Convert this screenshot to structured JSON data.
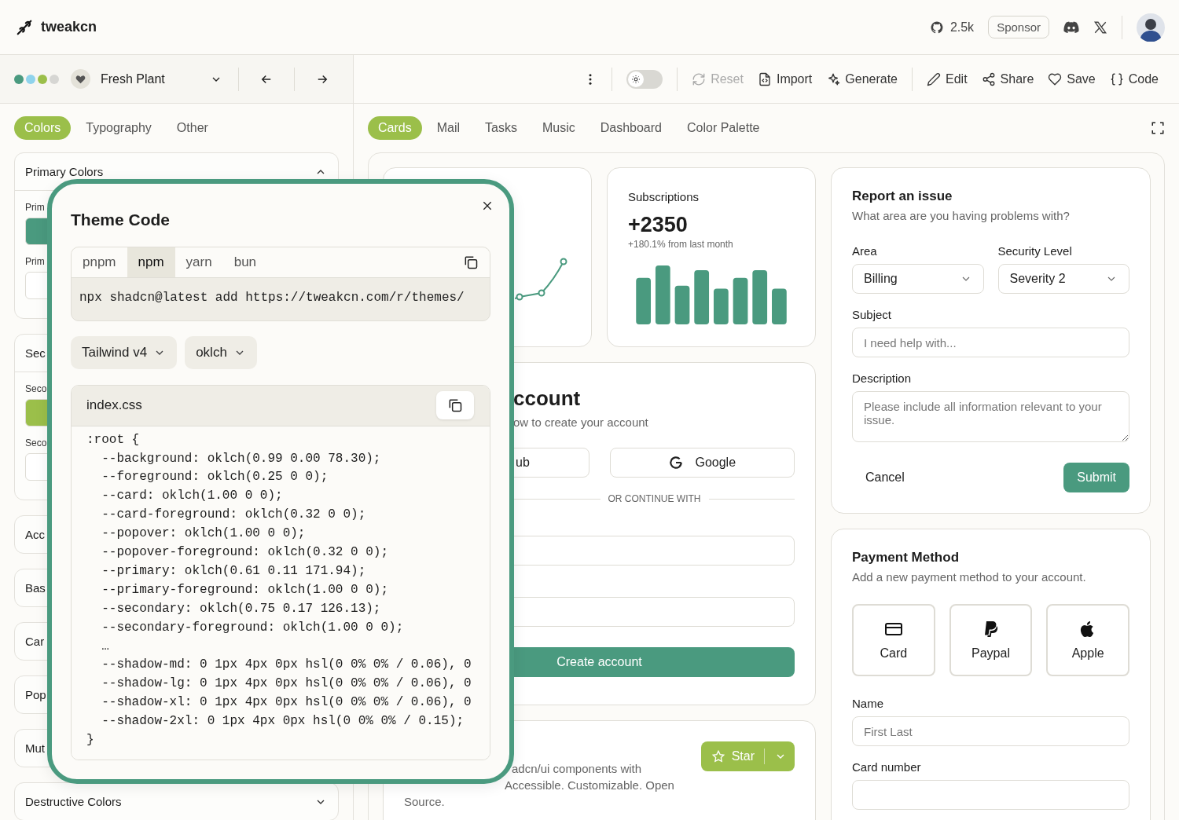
{
  "header": {
    "logo": "tweakcn",
    "github_stars": "2.5k",
    "sponsor": "Sponsor"
  },
  "theme_bar": {
    "swatches": [
      {
        "color": "#4a9a7f"
      },
      {
        "color": "#8fd3ec"
      },
      {
        "color": "#9bbf4a"
      },
      {
        "color": "#d6d6d3"
      }
    ],
    "theme_name": "Fresh Plant"
  },
  "toolbar": {
    "dark_mode": false,
    "action_groups": [
      [
        {
          "label": "Reset",
          "kind": "reset",
          "disabled": true
        },
        {
          "label": "Import",
          "kind": "import",
          "disabled": false
        },
        {
          "label": "Generate",
          "kind": "generate",
          "disabled": false
        }
      ],
      [
        {
          "label": "Edit",
          "kind": "edit",
          "disabled": false
        },
        {
          "label": "Share",
          "kind": "share",
          "disabled": false
        },
        {
          "label": "Save",
          "kind": "save",
          "disabled": false
        },
        {
          "label": "Code",
          "kind": "code",
          "disabled": false
        }
      ]
    ]
  },
  "editor_tabs": [
    {
      "label": "Colors",
      "selected": true
    },
    {
      "label": "Typography",
      "selected": false
    },
    {
      "label": "Other",
      "selected": false
    }
  ],
  "color_sections": [
    {
      "title": "Primary Colors",
      "expanded": true,
      "fields": [
        {
          "label": "Prim",
          "color": "#4a9a7f"
        },
        {
          "label": "Prim",
          "color": "#ffffff"
        }
      ]
    },
    {
      "title": "Sec",
      "fields": [
        {
          "label": "Seco",
          "color": "#9bbf4a"
        },
        {
          "label": "Seco",
          "color": "#ffffff"
        }
      ]
    },
    {
      "title": "Acc"
    },
    {
      "title": "Bas"
    },
    {
      "title": "Car"
    },
    {
      "title": "Pop"
    },
    {
      "title": "Mut"
    },
    {
      "title": "Destructive Colors",
      "expanded": false
    }
  ],
  "preview_tabs": [
    {
      "label": "Cards",
      "selected": true
    },
    {
      "label": "Mail",
      "selected": false
    },
    {
      "label": "Tasks",
      "selected": false
    },
    {
      "label": "Music",
      "selected": false
    },
    {
      "label": "Dashboard",
      "selected": false
    },
    {
      "label": "Color Palette",
      "selected": false
    }
  ],
  "subscriptions": {
    "title": "Subscriptions",
    "value": "+2350",
    "change": "+180.1% from last month"
  },
  "account": {
    "title": "ccount",
    "subtitle": "ow to create your account",
    "buttons": [
      {
        "label": "ub",
        "kind": "github"
      },
      {
        "label": "Google",
        "kind": "google"
      }
    ],
    "divider": "OR CONTINUE WITH",
    "submit": "Create account"
  },
  "repo": {
    "line_1": "adcn/ui components with",
    "line_2": "Accessible. Customizable. Open Source.",
    "star": "Star"
  },
  "report": {
    "title": "Report an issue",
    "subtitle": "What area are you having problems with?",
    "area": {
      "label": "Area",
      "value": "Billing"
    },
    "level": {
      "label": "Security Level",
      "value": "Severity 2"
    },
    "subject": {
      "label": "Subject",
      "placeholder": "I need help with..."
    },
    "description": {
      "label": "Description",
      "placeholder": "Please include all information relevant to your issue."
    },
    "cancel": "Cancel",
    "submit": "Submit"
  },
  "payment": {
    "title": "Payment Method",
    "subtitle": "Add a new payment method to your account.",
    "methods": [
      {
        "label": "Card",
        "kind": "card"
      },
      {
        "label": "Paypal",
        "kind": "paypal"
      },
      {
        "label": "Apple",
        "kind": "apple"
      }
    ],
    "name": {
      "label": "Name",
      "placeholder": "First Last"
    },
    "card_number": {
      "label": "Card number"
    }
  },
  "modal": {
    "title": "Theme Code",
    "package_managers": [
      {
        "label": "pnpm",
        "selected": false
      },
      {
        "label": "npm",
        "selected": true
      },
      {
        "label": "yarn",
        "selected": false
      },
      {
        "label": "bun",
        "selected": false
      }
    ],
    "command": "npx shadcn@latest add https://tweakcn.com/r/themes/",
    "format": "Tailwind v4",
    "color_format": "oklch",
    "file": "index.css",
    "code_lines": [
      ":root {",
      "  --background: oklch(0.99 0.00 78.30);",
      "  --foreground: oklch(0.25 0 0);",
      "  --card: oklch(1.00 0 0);",
      "  --card-foreground: oklch(0.32 0 0);",
      "  --popover: oklch(1.00 0 0);",
      "  --popover-foreground: oklch(0.32 0 0);",
      "  --primary: oklch(0.61 0.11 171.94);",
      "  --primary-foreground: oklch(1.00 0 0);",
      "  --secondary: oklch(0.75 0.17 126.13);",
      "  --secondary-foreground: oklch(1.00 0 0);",
      "  …",
      "  --shadow-md: 0 1px 4px 0px hsl(0 0% 0% / 0.06), 0",
      "  --shadow-lg: 0 1px 4px 0px hsl(0 0% 0% / 0.06), 0",
      "  --shadow-xl: 0 1px 4px 0px hsl(0 0% 0% / 0.06), 0",
      "  --shadow-2xl: 0 1px 4px 0px hsl(0 0% 0% / 0.15);",
      "}"
    ]
  }
}
